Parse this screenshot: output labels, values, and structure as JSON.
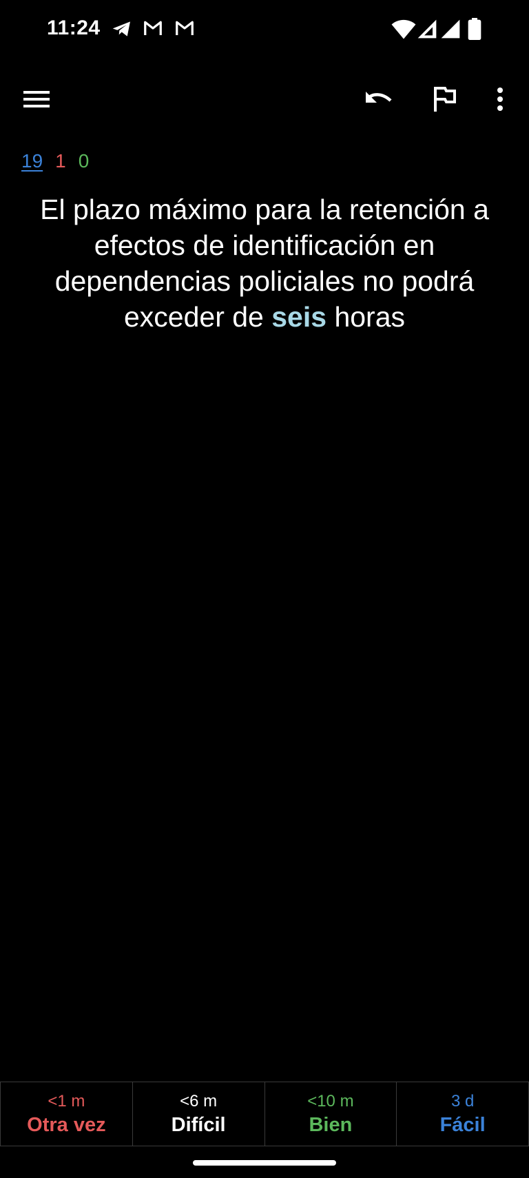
{
  "status_bar": {
    "time": "11:24",
    "icons_left": [
      "telegram-icon",
      "gmail-icon",
      "gmail-icon"
    ],
    "icons_right": [
      "wifi-icon",
      "signal-icon",
      "signal-icon",
      "battery-icon"
    ]
  },
  "toolbar": {
    "menu_icon": "menu-icon",
    "undo_icon": "undo-icon",
    "flag_icon": "flag-icon",
    "more_icon": "more-vert-icon"
  },
  "counts": {
    "new": "19",
    "learning": "1",
    "review": "0",
    "colors": {
      "new": "#3b82d9",
      "learning": "#e55a5a",
      "review": "#5cb85c"
    }
  },
  "card": {
    "text_before": "El plazo máximo para la retención a efectos de identificación en dependencias policiales no podrá exceder de ",
    "cloze": "seis",
    "text_after": " horas",
    "cloze_color": "#a8d8e6"
  },
  "answers": [
    {
      "time": "<1 m",
      "label": "Otra vez",
      "color": "#e55a5a"
    },
    {
      "time": "<6 m",
      "label": "Difícil",
      "color": "#ffffff"
    },
    {
      "time": "<10 m",
      "label": "Bien",
      "color": "#5cb85c"
    },
    {
      "time": "3 d",
      "label": "Fácil",
      "color": "#3b82d9"
    }
  ]
}
